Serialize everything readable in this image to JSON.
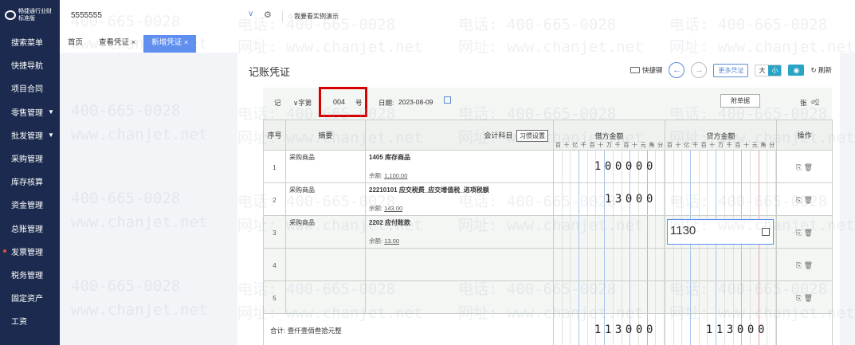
{
  "app": {
    "logo_line1": "畅捷通行业财",
    "logo_line2": "标准版",
    "company": "5555555",
    "demo_label": "我要看实例演示"
  },
  "sidebar": {
    "items": [
      {
        "label": "搜索菜单"
      },
      {
        "label": "快捷导航"
      },
      {
        "label": "项目合同"
      },
      {
        "label": "零售管理",
        "caret": "▼"
      },
      {
        "label": "批发管理",
        "caret": "▼"
      },
      {
        "label": "采购管理"
      },
      {
        "label": "库存核算"
      },
      {
        "label": "资金管理"
      },
      {
        "label": "总账管理"
      },
      {
        "label": "发票管理"
      },
      {
        "label": "税务管理"
      },
      {
        "label": "固定资产"
      },
      {
        "label": "工资"
      }
    ]
  },
  "tabs": [
    {
      "label": "首页"
    },
    {
      "label": "查看凭证 ×"
    },
    {
      "label": "新增凭证 ×"
    }
  ],
  "page": {
    "title": "记账凭证",
    "shortcut": "快捷键",
    "more_vouchers": "更多凭证",
    "size_big": "大",
    "size_small": "小",
    "refresh": "刷新"
  },
  "voucher": {
    "word_label": "记",
    "word_select": "∨字第",
    "number": "004",
    "hao": "号",
    "date_label": "日期:",
    "date": "2023-08-09",
    "attach_label": "附单据",
    "zhang": "张",
    "attach_count": "0"
  },
  "table": {
    "headers": {
      "seq": "序号",
      "summary": "摘要",
      "account": "会计科目",
      "habit": "习惯设置",
      "debit": "借方金额",
      "credit": "贷方金额",
      "ops": "操作"
    },
    "digit_units": [
      "百",
      "十",
      "亿",
      "千",
      "百",
      "十",
      "万",
      "千",
      "百",
      "十",
      "元",
      "角",
      "分"
    ],
    "rows": [
      {
        "seq": "1",
        "summary": "采购商品",
        "account": "1405 库存商品",
        "bal_label": "余额:",
        "balance": "1,100.00",
        "debit": "100000",
        "credit": ""
      },
      {
        "seq": "2",
        "summary": "采购商品",
        "account": "22210101 应交税费_应交增值税_进项税额",
        "bal_label": "余额:",
        "balance": "143.00",
        "debit": "13000",
        "credit": ""
      },
      {
        "seq": "3",
        "summary": "采购商品",
        "account": "2202 应付账款",
        "bal_label": "余额:",
        "balance": "13.00",
        "debit": "",
        "credit_input": "1130"
      },
      {
        "seq": "4",
        "summary": "",
        "account": "",
        "debit": "",
        "credit": ""
      },
      {
        "seq": "5",
        "summary": "",
        "account": "",
        "debit": "",
        "credit": ""
      }
    ],
    "total_label": "合计: 壹仟壹佰叁拾元整",
    "total_debit": "113000",
    "total_credit": "113000"
  },
  "watermark": {
    "phone": "400-665-0028",
    "phone_tel": "电话: 400-665-0028",
    "site": "www.chanjet.net",
    "site_url": "网址: www.chanjet.net"
  }
}
